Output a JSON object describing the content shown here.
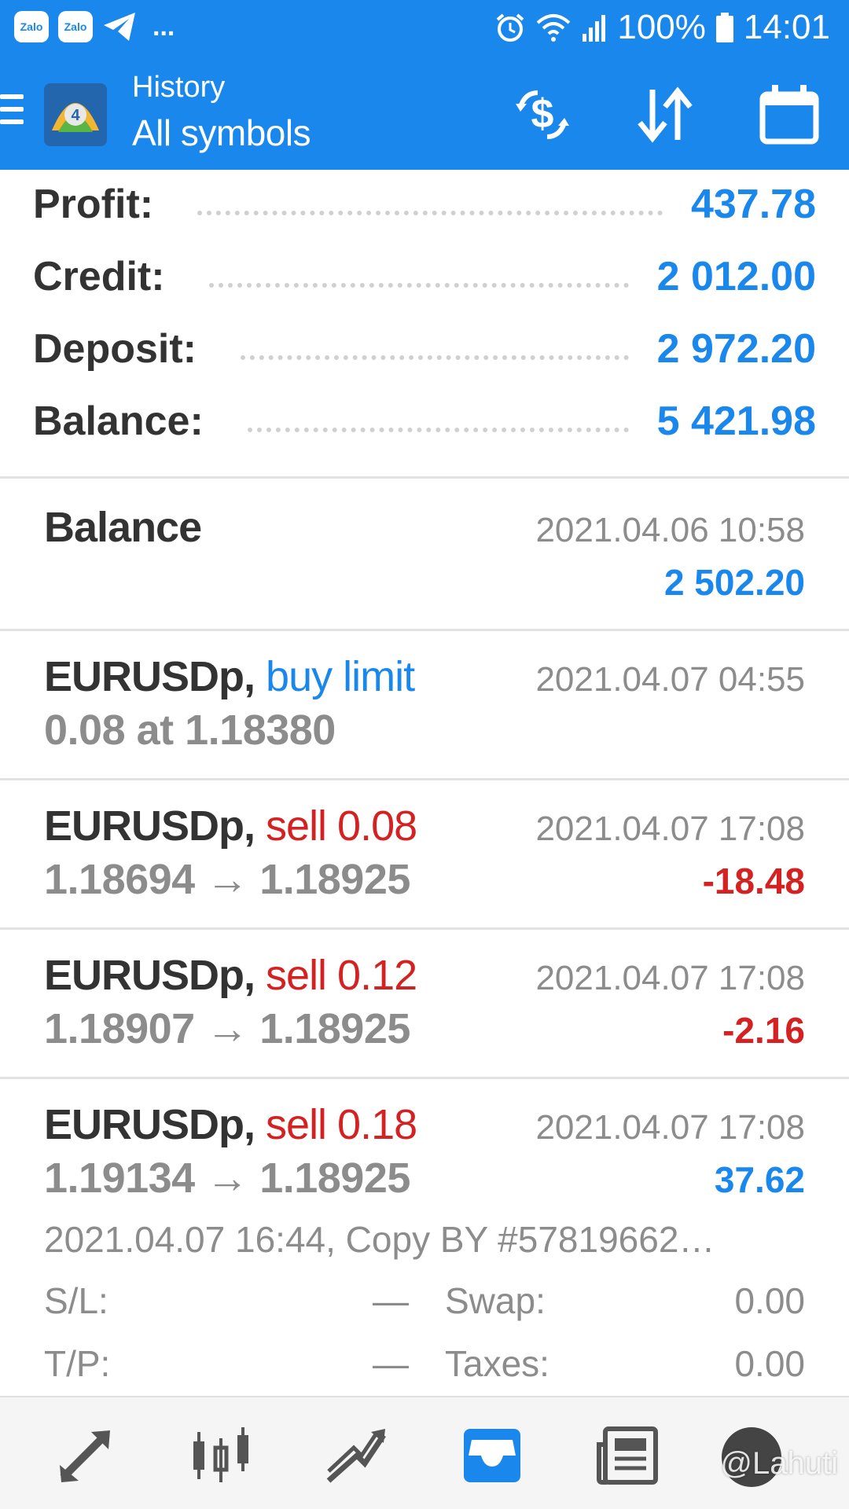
{
  "status_bar": {
    "left_icons": [
      "Zalo",
      "Zalo"
    ],
    "more": "...",
    "battery": "100%",
    "time": "14:01"
  },
  "header": {
    "subtitle": "History",
    "title": "All symbols",
    "icons": [
      "currency-exchange-icon",
      "sort-icon",
      "calendar-icon"
    ]
  },
  "summary": [
    {
      "label": "Profit:",
      "value": "437.78"
    },
    {
      "label": "Credit:",
      "value": "2 012.00"
    },
    {
      "label": "Deposit:",
      "value": "2 972.20"
    },
    {
      "label": "Balance:",
      "value": "5 421.98"
    }
  ],
  "history": [
    {
      "type": "balance",
      "title": "Balance",
      "date": "2021.04.06 10:58",
      "amount": "2 502.20"
    },
    {
      "type": "order",
      "symbol": "EURUSDp,",
      "action": "buy limit",
      "details": "0.08 at 1.18380",
      "date": "2021.04.07 04:55"
    },
    {
      "type": "deal",
      "symbol": "EURUSDp,",
      "action": "sell 0.08",
      "details": "1.18694 → 1.18925",
      "date": "2021.04.07 17:08",
      "amount": "-18.48"
    },
    {
      "type": "deal",
      "symbol": "EURUSDp,",
      "action": "sell 0.12",
      "details": "1.18907 → 1.18925",
      "date": "2021.04.07 17:08",
      "amount": "-2.16"
    },
    {
      "type": "deal",
      "symbol": "EURUSDp,",
      "action": "sell 0.18",
      "details": "1.19134 → 1.18925",
      "date": "2021.04.07 17:08",
      "amount": "37.62",
      "expanded": {
        "comment": "2021.04.07 16:44, Copy BY #57819662…",
        "sl_label": "S/L:",
        "sl_value": "—",
        "swap_label": "Swap:",
        "swap_value": "0.00",
        "tp_label": "T/P:",
        "tp_value": "—",
        "taxes_label": "Taxes:",
        "taxes_value": "0.00"
      }
    }
  ],
  "bottom_nav": {
    "items": [
      "quotes-icon",
      "chart-icon",
      "trade-icon",
      "history-icon",
      "news-icon",
      "chat-icon"
    ],
    "active": "history-icon",
    "watermark": "@Lahuti"
  },
  "colors": {
    "accent": "#1a87ec",
    "loss": "#d42121",
    "muted": "#8c8c8c",
    "text": "#333333"
  }
}
